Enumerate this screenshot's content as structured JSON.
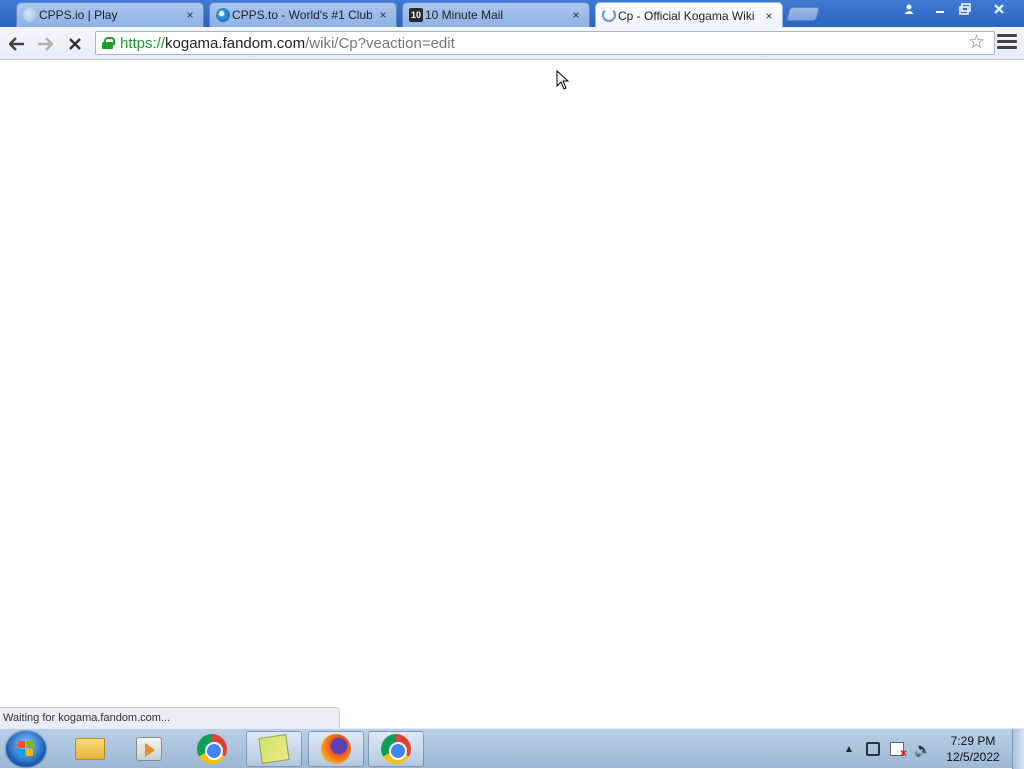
{
  "browser": {
    "tabs": [
      {
        "title": "CPPS.io | Play",
        "favicon": "cpps-io-favicon",
        "active": false
      },
      {
        "title": "CPPS.to - World's #1 Club",
        "favicon": "cpps-to-favicon",
        "active": false
      },
      {
        "title": "10 Minute Mail",
        "favicon": "10-minute-mail-favicon",
        "favicon_text": "10",
        "active": false
      },
      {
        "title": "Cp - Official Kogama Wiki",
        "favicon": "loading-spinner",
        "active": true
      }
    ],
    "close_glyph": "×",
    "address": {
      "scheme": "https://",
      "host": "kogama.fandom.com",
      "path": "/wiki/Cp?veaction=edit"
    },
    "status_text": "Waiting for kogama.fandom.com..."
  },
  "taskbar": {
    "apps": [
      {
        "name": "windows-explorer",
        "active": false
      },
      {
        "name": "media-player",
        "active": false
      },
      {
        "name": "google-chrome",
        "active": false
      },
      {
        "name": "sticky-notes",
        "active": false
      },
      {
        "name": "firefox",
        "active": true
      },
      {
        "name": "google-chrome",
        "active": true
      }
    ],
    "clock": {
      "time": "7:29 PM",
      "date": "12/5/2022"
    }
  },
  "colors": {
    "secure_green": "#1a9e2c",
    "titlebar_blue": "#2c63c1",
    "taskbar": "#9db8d6"
  }
}
